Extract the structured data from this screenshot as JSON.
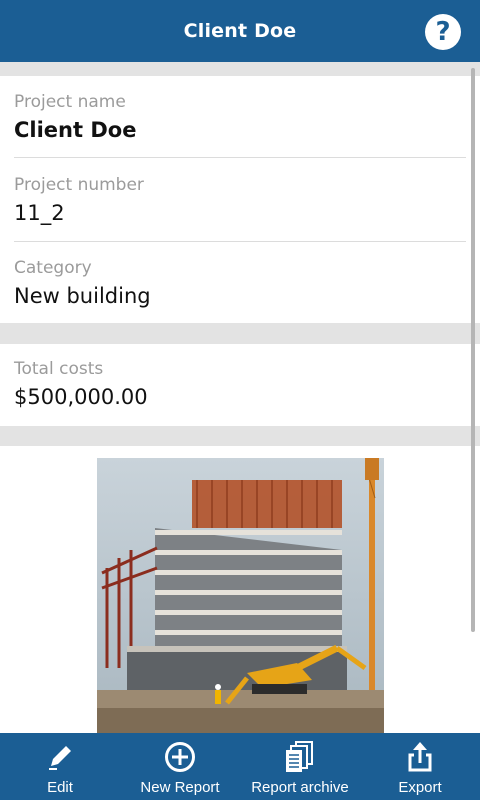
{
  "header": {
    "title": "Client Doe",
    "help_icon": "help-icon"
  },
  "project": {
    "name_label": "Project name",
    "name_value": "Client Doe",
    "number_label": "Project number",
    "number_value": "11_2",
    "category_label": "Category",
    "category_value": "New building"
  },
  "costs": {
    "label": "Total costs",
    "value": "$500,000.00"
  },
  "photo": {
    "subject": "building-under-construction-photo"
  },
  "toolbar": {
    "items": [
      {
        "label": "Edit",
        "icon": "pencil-icon"
      },
      {
        "label": "New Report",
        "icon": "plus-circle-icon"
      },
      {
        "label": "Report archive",
        "icon": "documents-icon"
      },
      {
        "label": "Export",
        "icon": "share-icon"
      }
    ]
  },
  "colors": {
    "brand": "#1b5e94",
    "background": "#e3e3e3",
    "label": "#9b9b9b"
  }
}
